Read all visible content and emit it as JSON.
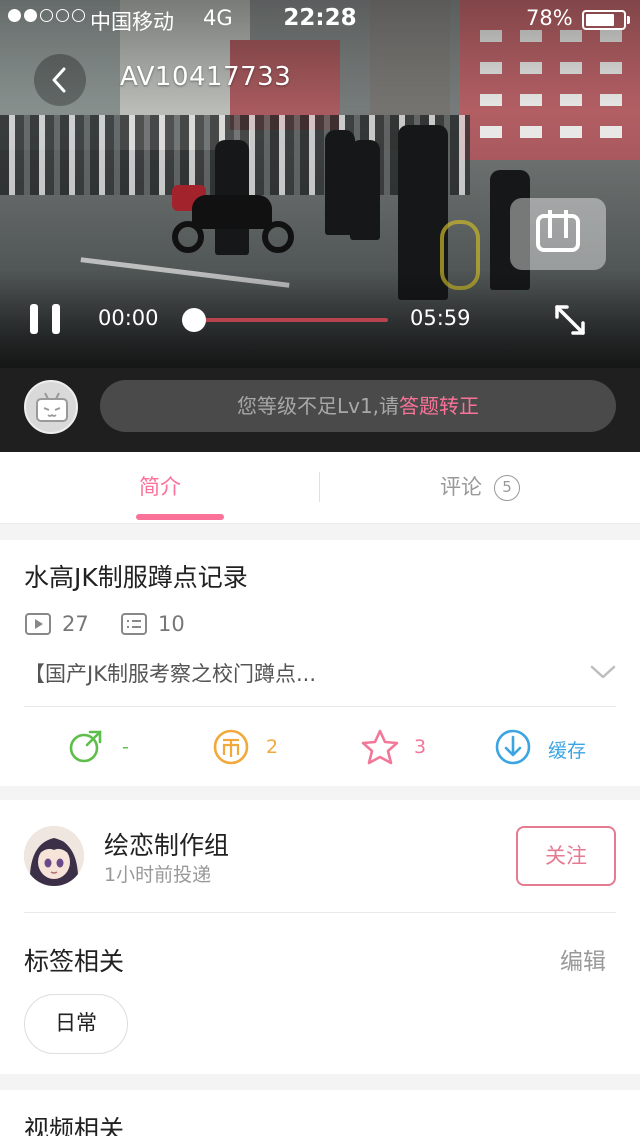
{
  "status_bar": {
    "carrier": "中国移动",
    "network": "4G",
    "time": "22:28",
    "battery": "78%",
    "battery_level": 0.78,
    "signal_bars": 2
  },
  "player": {
    "video_id": "AV10417733",
    "current_time": "00:00",
    "total_time": "05:59",
    "progress": 0.0
  },
  "comment_bar": {
    "prompt": "您等级不足Lv1,请",
    "link": "答题转正"
  },
  "tabs": {
    "intro": "简介",
    "comments": "评论",
    "comments_count": "5",
    "active": "intro"
  },
  "video": {
    "title": "水高JK制服蹲点记录",
    "plays": "27",
    "danmaku": "10",
    "description": "【国产JK制服考察之校门蹲点..."
  },
  "actions": {
    "share": "-",
    "coins": "2",
    "favorites": "3",
    "cache": "缓存"
  },
  "uploader": {
    "name": "绘恋制作组",
    "posted": "1小时前投递",
    "follow": "关注"
  },
  "tags": {
    "heading": "标签相关",
    "edit": "编辑",
    "items": [
      "日常"
    ]
  },
  "related": {
    "heading": "视频相关"
  },
  "colors": {
    "accent": "#fb7299",
    "share": "#5dbf4a",
    "coin": "#f2a93b",
    "favorite": "#f2789a",
    "cache": "#3ca4e3"
  }
}
